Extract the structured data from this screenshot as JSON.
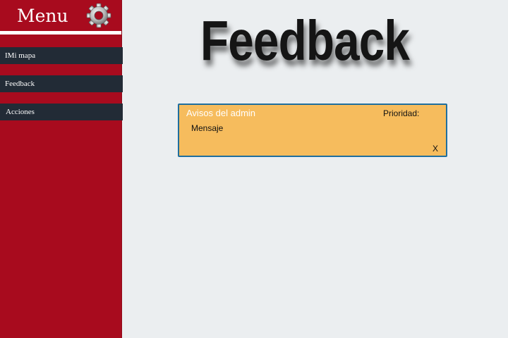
{
  "sidebar": {
    "title": "Menu",
    "settings_icon": "gear-icon",
    "items": [
      {
        "label": "IMi mapa"
      },
      {
        "label": "Feedback"
      },
      {
        "label": "Acciones"
      }
    ]
  },
  "main": {
    "page_title": "Feedback",
    "notice": {
      "title": "Avisos del admin",
      "priority_label": "Prioridad:",
      "message": "Mensaje",
      "close_label": "X"
    }
  },
  "colors": {
    "sidebar_bg": "#a80b1e",
    "nav_item_bg": "#222b36",
    "notice_bg": "#f6bc5d",
    "notice_border": "#1f6e9e",
    "page_bg": "#ebeef0"
  }
}
